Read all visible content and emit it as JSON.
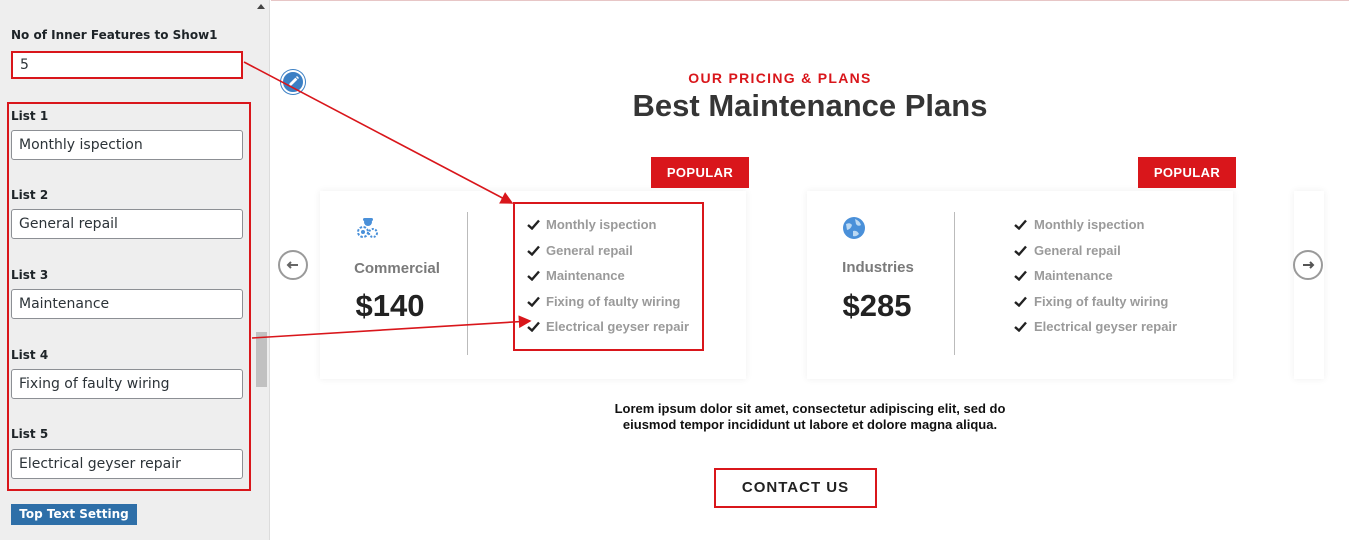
{
  "panel": {
    "count_label": "No of Inner Features to Show1",
    "count_value": "5",
    "lists": [
      {
        "label": "List 1",
        "value": "Monthly ispection"
      },
      {
        "label": "List 2",
        "value": "General repail"
      },
      {
        "label": "List 3",
        "value": "Maintenance"
      },
      {
        "label": "List 4",
        "value": "Fixing of faulty wiring"
      },
      {
        "label": "List 5",
        "value": "Electrical geyser repair"
      }
    ],
    "top_text_button": "Top Text Setting"
  },
  "preview": {
    "subtitle": "OUR PRICING & PLANS",
    "title": "Best Maintenance Plans",
    "plans": [
      {
        "badge": "POPULAR",
        "icon": "gears-worker-icon",
        "name": "Commercial",
        "price": "$140",
        "features": [
          "Monthly ispection",
          "General repail",
          "Maintenance",
          "Fixing of faulty wiring",
          "Electrical geyser repair"
        ]
      },
      {
        "badge": "POPULAR",
        "icon": "globe-icon",
        "name": "Industries",
        "price": "$285",
        "features": [
          "Monthly ispection",
          "General repail",
          "Maintenance",
          "Fixing of faulty wiring",
          "Electrical geyser repair"
        ]
      }
    ],
    "description_line1": "Lorem ipsum dolor sit amet, consectetur adipiscing elit, sed do",
    "description_line2": "eiusmod tempor incididunt ut labore et dolore magna aliqua.",
    "contact_button": "CONTACT US"
  },
  "colors": {
    "accent_red": "#d9161b",
    "button_blue": "#2e6fa8",
    "icon_blue": "#4a90d9"
  }
}
